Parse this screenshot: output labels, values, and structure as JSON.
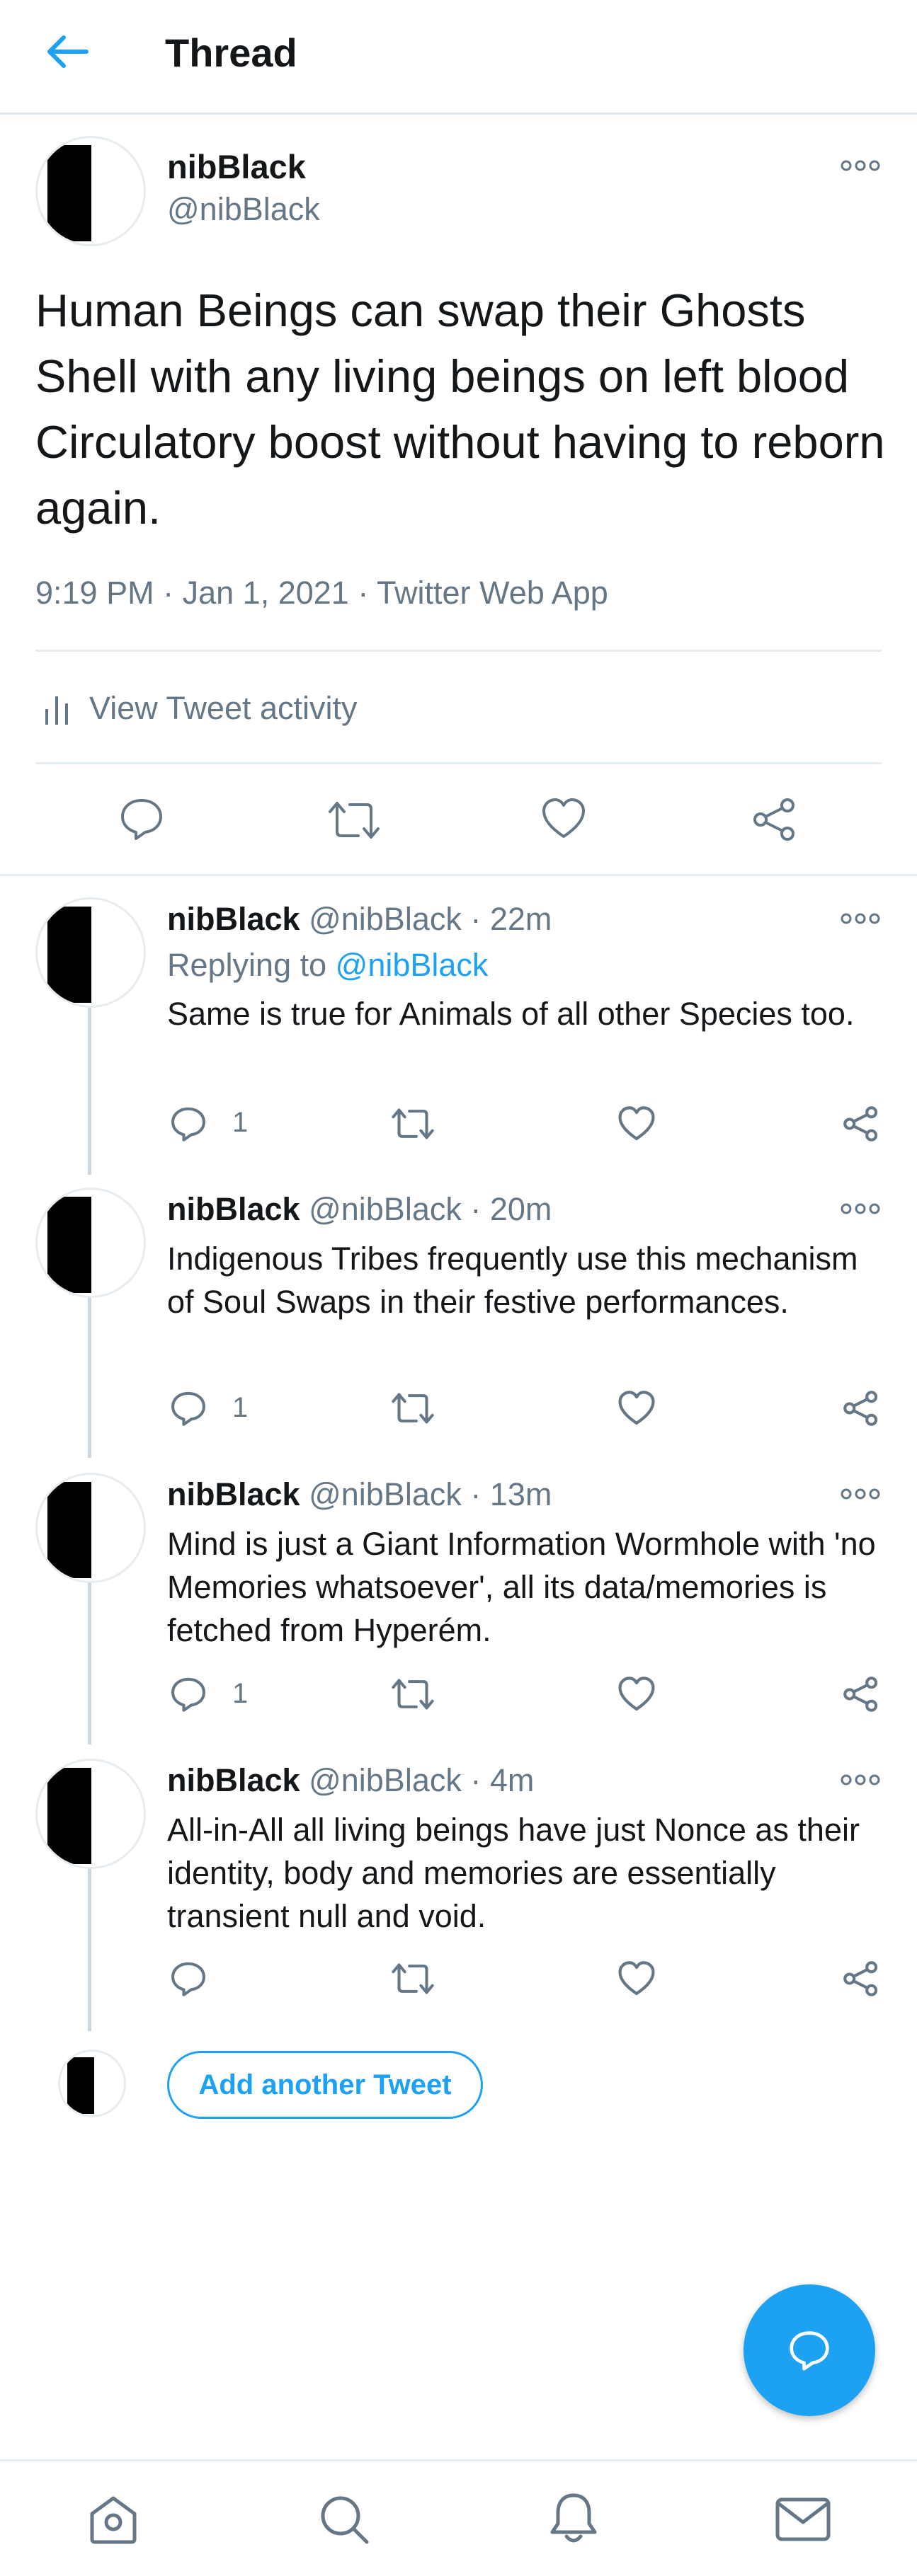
{
  "header": {
    "title": "Thread"
  },
  "main_tweet": {
    "name": "nibBlack",
    "handle": "@nibBlack",
    "text": "Human Beings can swap their Ghosts Shell with any living beings on left blood Circulatory boost without having to reborn again.",
    "time": "9:19 PM",
    "date": "Jan 1, 2021",
    "source": "Twitter Web App",
    "activity_label": "View Tweet activity"
  },
  "replies": [
    {
      "name": "nibBlack",
      "handle": "@nibBlack",
      "age": "22m",
      "replying_prefix": "Replying to",
      "replying_to": "@nibBlack",
      "text": "Same is true for Animals of all other Species too.",
      "reply_count": "1"
    },
    {
      "name": "nibBlack",
      "handle": "@nibBlack",
      "age": "20m",
      "text": "Indigenous Tribes frequently use this mechanism of Soul Swaps in their festive performances.",
      "reply_count": "1"
    },
    {
      "name": "nibBlack",
      "handle": "@nibBlack",
      "age": "13m",
      "text": "Mind is just a Giant Information Wormhole with 'no Memories whatsoever', all its data/memories is fetched from Hyperém.",
      "reply_count": "1"
    },
    {
      "name": "nibBlack",
      "handle": "@nibBlack",
      "age": "4m",
      "text": "All-in-All all living beings have just Nonce as their identity, body and memories are essentially transient null and void.",
      "reply_count": ""
    }
  ],
  "composer": {
    "add_label": "Add another Tweet"
  },
  "colors": {
    "accent": "#1da1f2",
    "text": "#14171a",
    "secondary": "#657786",
    "divider": "#e6ecf0"
  },
  "icons": [
    "back-arrow-icon",
    "more-icon",
    "reply-icon",
    "retweet-icon",
    "like-icon",
    "share-icon",
    "activity-icon",
    "compose-icon",
    "home-icon",
    "search-icon",
    "notifications-icon",
    "messages-icon"
  ]
}
